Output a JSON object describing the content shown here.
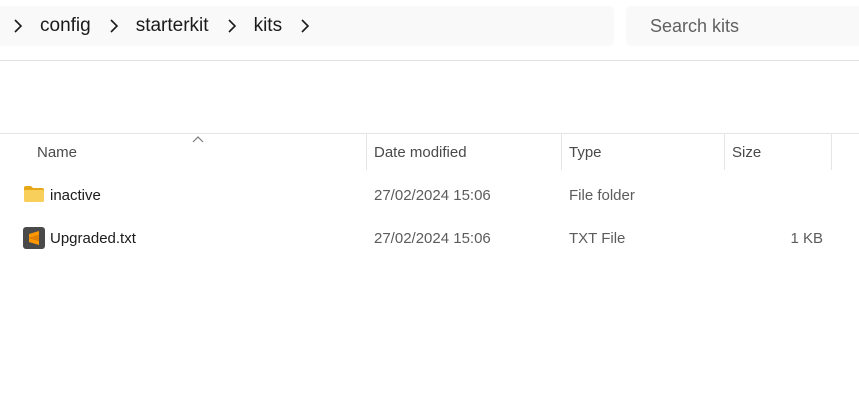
{
  "breadcrumb": {
    "items": [
      {
        "label": "config"
      },
      {
        "label": "starterkit"
      },
      {
        "label": "kits"
      }
    ]
  },
  "search": {
    "placeholder": "Search kits"
  },
  "columns": {
    "name": "Name",
    "date": "Date modified",
    "type": "Type",
    "size": "Size"
  },
  "files": [
    {
      "name": "inactive",
      "date": "27/02/2024 15:06",
      "type": "File folder",
      "size": "",
      "icon": "folder-icon"
    },
    {
      "name": "Upgraded.txt",
      "date": "27/02/2024 15:06",
      "type": "TXT File",
      "size": "1 KB",
      "icon": "sublime-text-icon"
    }
  ],
  "colors": {
    "folder": "#f4c542",
    "folder_dark": "#e6a817",
    "sublime_bg": "#4a4a4a",
    "sublime_accent": "#ff9800"
  }
}
